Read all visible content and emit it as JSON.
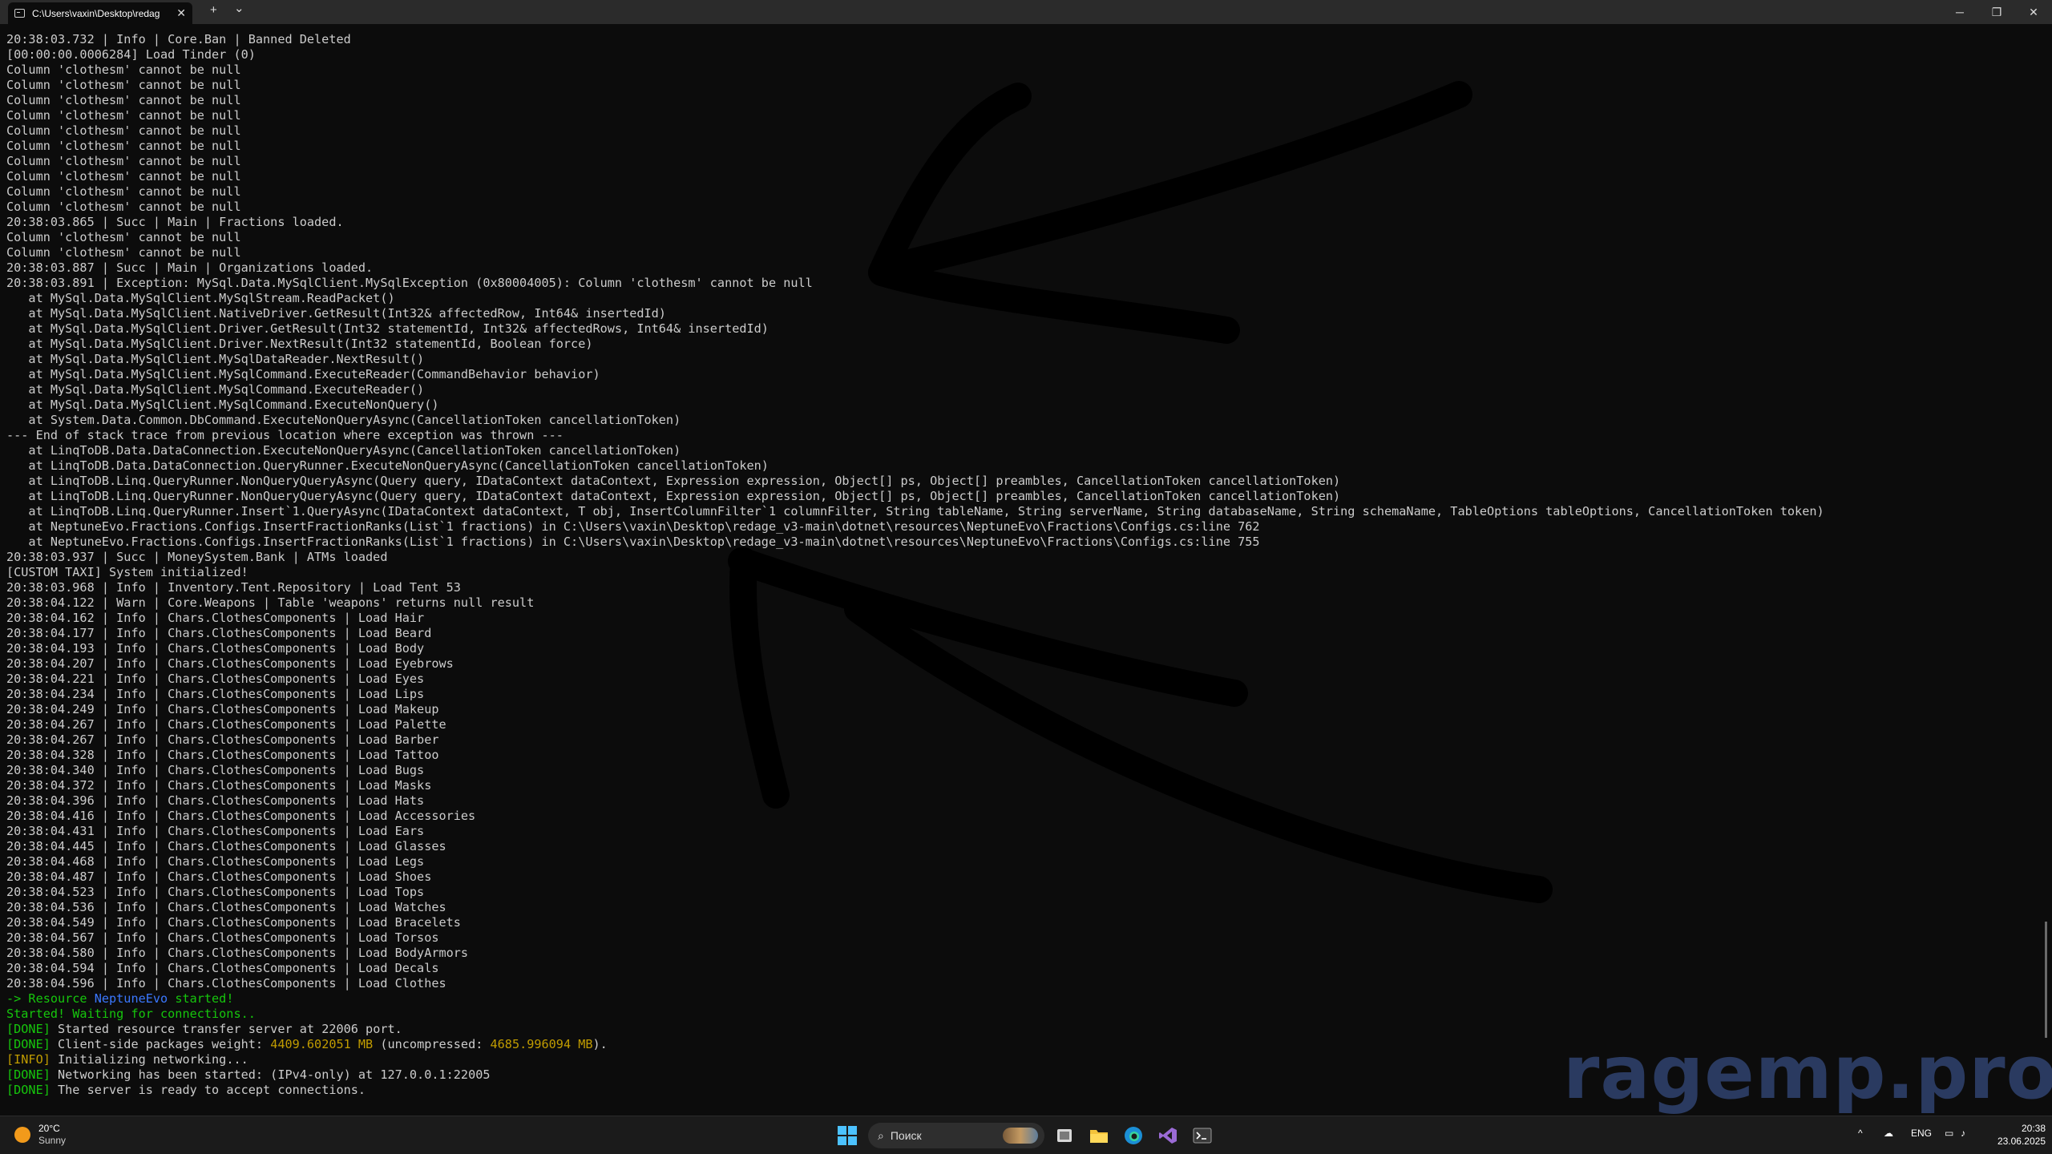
{
  "window": {
    "tab_title": "C:\\Users\\vaxin\\Desktop\\redag",
    "tab_close": "✕",
    "new_tab": "+",
    "dropdown": "⌄",
    "minimize": "─",
    "maximize": "❐",
    "close": "✕"
  },
  "console": {
    "lines": [
      [
        {
          "t": "20:38:03.732 | Info | Core.Ban | Banned Deleted"
        }
      ],
      [
        {
          "t": "[00:00:00.0006284] Load Tinder (0)"
        }
      ],
      [
        {
          "t": "Column 'clothesm' cannot be null"
        }
      ],
      [
        {
          "t": "Column 'clothesm' cannot be null"
        }
      ],
      [
        {
          "t": "Column 'clothesm' cannot be null"
        }
      ],
      [
        {
          "t": "Column 'clothesm' cannot be null"
        }
      ],
      [
        {
          "t": "Column 'clothesm' cannot be null"
        }
      ],
      [
        {
          "t": "Column 'clothesm' cannot be null"
        }
      ],
      [
        {
          "t": "Column 'clothesm' cannot be null"
        }
      ],
      [
        {
          "t": "Column 'clothesm' cannot be null"
        }
      ],
      [
        {
          "t": "Column 'clothesm' cannot be null"
        }
      ],
      [
        {
          "t": "Column 'clothesm' cannot be null"
        }
      ],
      [
        {
          "t": "20:38:03.865 | Succ | Main | Fractions loaded."
        }
      ],
      [
        {
          "t": "Column 'clothesm' cannot be null"
        }
      ],
      [
        {
          "t": "Column 'clothesm' cannot be null"
        }
      ],
      [
        {
          "t": "20:38:03.887 | Succ | Main | Organizations loaded."
        }
      ],
      [
        {
          "t": "20:38:03.891 | Exception: MySql.Data.MySqlClient.MySqlException (0x80004005): Column 'clothesm' cannot be null"
        }
      ],
      [
        {
          "t": "   at MySql.Data.MySqlClient.MySqlStream.ReadPacket()"
        }
      ],
      [
        {
          "t": "   at MySql.Data.MySqlClient.NativeDriver.GetResult(Int32& affectedRow, Int64& insertedId)"
        }
      ],
      [
        {
          "t": "   at MySql.Data.MySqlClient.Driver.GetResult(Int32 statementId, Int32& affectedRows, Int64& insertedId)"
        }
      ],
      [
        {
          "t": "   at MySql.Data.MySqlClient.Driver.NextResult(Int32 statementId, Boolean force)"
        }
      ],
      [
        {
          "t": "   at MySql.Data.MySqlClient.MySqlDataReader.NextResult()"
        }
      ],
      [
        {
          "t": "   at MySql.Data.MySqlClient.MySqlCommand.ExecuteReader(CommandBehavior behavior)"
        }
      ],
      [
        {
          "t": "   at MySql.Data.MySqlClient.MySqlCommand.ExecuteReader()"
        }
      ],
      [
        {
          "t": "   at MySql.Data.MySqlClient.MySqlCommand.ExecuteNonQuery()"
        }
      ],
      [
        {
          "t": "   at System.Data.Common.DbCommand.ExecuteNonQueryAsync(CancellationToken cancellationToken)"
        }
      ],
      [
        {
          "t": "--- End of stack trace from previous location where exception was thrown ---"
        }
      ],
      [
        {
          "t": "   at LinqToDB.Data.DataConnection.ExecuteNonQueryAsync(CancellationToken cancellationToken)"
        }
      ],
      [
        {
          "t": "   at LinqToDB.Data.DataConnection.QueryRunner.ExecuteNonQueryAsync(CancellationToken cancellationToken)"
        }
      ],
      [
        {
          "t": "   at LinqToDB.Linq.QueryRunner.NonQueryQueryAsync(Query query, IDataContext dataContext, Expression expression, Object[] ps, Object[] preambles, CancellationToken cancellationToken)"
        }
      ],
      [
        {
          "t": "   at LinqToDB.Linq.QueryRunner.NonQueryQueryAsync(Query query, IDataContext dataContext, Expression expression, Object[] ps, Object[] preambles, CancellationToken cancellationToken)"
        }
      ],
      [
        {
          "t": "   at LinqToDB.Linq.QueryRunner.Insert`1.QueryAsync(IDataContext dataContext, T obj, InsertColumnFilter`1 columnFilter, String tableName, String serverName, String databaseName, String schemaName, TableOptions tableOptions, CancellationToken token)"
        }
      ],
      [
        {
          "t": "   at NeptuneEvo.Fractions.Configs.InsertFractionRanks(List`1 fractions) in C:\\Users\\vaxin\\Desktop\\redage_v3-main\\dotnet\\resources\\NeptuneEvo\\Fractions\\Configs.cs:line 762"
        }
      ],
      [
        {
          "t": "   at NeptuneEvo.Fractions.Configs.InsertFractionRanks(List`1 fractions) in C:\\Users\\vaxin\\Desktop\\redage_v3-main\\dotnet\\resources\\NeptuneEvo\\Fractions\\Configs.cs:line 755"
        }
      ],
      [
        {
          "t": "20:38:03.937 | Succ | MoneySystem.Bank | ATMs loaded"
        }
      ],
      [
        {
          "t": "[CUSTOM TAXI] System initialized!"
        }
      ],
      [
        {
          "t": "20:38:03.968 | Info | Inventory.Tent.Repository | Load Tent 53"
        }
      ],
      [
        {
          "t": "20:38:04.122 | Warn | Core.Weapons | Table 'weapons' returns null result"
        }
      ],
      [
        {
          "t": "20:38:04.162 | Info | Chars.ClothesComponents | Load Hair"
        }
      ],
      [
        {
          "t": "20:38:04.177 | Info | Chars.ClothesComponents | Load Beard"
        }
      ],
      [
        {
          "t": "20:38:04.193 | Info | Chars.ClothesComponents | Load Body"
        }
      ],
      [
        {
          "t": "20:38:04.207 | Info | Chars.ClothesComponents | Load Eyebrows"
        }
      ],
      [
        {
          "t": "20:38:04.221 | Info | Chars.ClothesComponents | Load Eyes"
        }
      ],
      [
        {
          "t": "20:38:04.234 | Info | Chars.ClothesComponents | Load Lips"
        }
      ],
      [
        {
          "t": "20:38:04.249 | Info | Chars.ClothesComponents | Load Makeup"
        }
      ],
      [
        {
          "t": "20:38:04.267 | Info | Chars.ClothesComponents | Load Palette"
        }
      ],
      [
        {
          "t": "20:38:04.267 | Info | Chars.ClothesComponents | Load Barber"
        }
      ],
      [
        {
          "t": "20:38:04.328 | Info | Chars.ClothesComponents | Load Tattoo"
        }
      ],
      [
        {
          "t": "20:38:04.340 | Info | Chars.ClothesComponents | Load Bugs"
        }
      ],
      [
        {
          "t": "20:38:04.372 | Info | Chars.ClothesComponents | Load Masks"
        }
      ],
      [
        {
          "t": "20:38:04.396 | Info | Chars.ClothesComponents | Load Hats"
        }
      ],
      [
        {
          "t": "20:38:04.416 | Info | Chars.ClothesComponents | Load Accessories"
        }
      ],
      [
        {
          "t": "20:38:04.431 | Info | Chars.ClothesComponents | Load Ears"
        }
      ],
      [
        {
          "t": "20:38:04.445 | Info | Chars.ClothesComponents | Load Glasses"
        }
      ],
      [
        {
          "t": "20:38:04.468 | Info | Chars.ClothesComponents | Load Legs"
        }
      ],
      [
        {
          "t": "20:38:04.487 | Info | Chars.ClothesComponents | Load Shoes"
        }
      ],
      [
        {
          "t": "20:38:04.523 | Info | Chars.ClothesComponents | Load Tops"
        }
      ],
      [
        {
          "t": "20:38:04.536 | Info | Chars.ClothesComponents | Load Watches"
        }
      ],
      [
        {
          "t": "20:38:04.549 | Info | Chars.ClothesComponents | Load Bracelets"
        }
      ],
      [
        {
          "t": "20:38:04.567 | Info | Chars.ClothesComponents | Load Torsos"
        }
      ],
      [
        {
          "t": "20:38:04.580 | Info | Chars.ClothesComponents | Load BodyArmors"
        }
      ],
      [
        {
          "t": "20:38:04.594 | Info | Chars.ClothesComponents | Load Decals"
        }
      ],
      [
        {
          "t": "20:38:04.596 | Info | Chars.ClothesComponents | Load Clothes"
        }
      ],
      [
        {
          "t": "-> Resource ",
          "c": "g"
        },
        {
          "t": "NeptuneEvo",
          "c": "b"
        },
        {
          "t": " started!",
          "c": "g"
        }
      ],
      [
        {
          "t": "Started! Waiting for connections..",
          "c": "g"
        }
      ],
      [
        {
          "t": "[DONE]",
          "c": "g"
        },
        {
          "t": " Started resource transfer server at 22006 port."
        }
      ],
      [
        {
          "t": "[DONE]",
          "c": "g"
        },
        {
          "t": " Client-side packages weight: "
        },
        {
          "t": "4409.602051 MB",
          "c": "y"
        },
        {
          "t": " (uncompressed: "
        },
        {
          "t": "4685.996094 MB",
          "c": "y"
        },
        {
          "t": ")."
        }
      ],
      [
        {
          "t": "[INFO]",
          "c": "y"
        },
        {
          "t": " Initializing networking..."
        }
      ],
      [
        {
          "t": "[DONE]",
          "c": "g"
        },
        {
          "t": " Networking has been started: (IPv4-only) at 127.0.0.1:22005"
        }
      ],
      [
        {
          "t": "[DONE]",
          "c": "g"
        },
        {
          "t": " The server is ready to accept connections."
        }
      ]
    ]
  },
  "watermark": "ragemp.pro",
  "taskbar": {
    "weather_temp": "20°C",
    "weather_cond": "Sunny",
    "search_icon": "search-icon",
    "search_placeholder": "Поиск",
    "tray_chevron": "^",
    "tray_lang": "ENG",
    "clock_time": "20:38",
    "clock_date": "23.06.2025"
  },
  "colors": {
    "background": "#0c0c0c",
    "text": "#cccccc",
    "green": "#16c60c",
    "blue": "#3b78ff",
    "yellow": "#c19c00"
  }
}
